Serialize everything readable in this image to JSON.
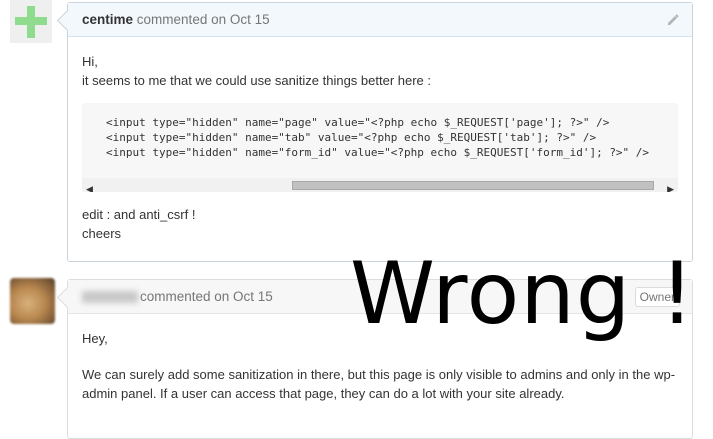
{
  "comment1": {
    "author": "centime",
    "action": "commented on Oct 15",
    "lines": [
      "Hi,",
      "it seems to me that we could use sanitize things better here :"
    ],
    "code_lines": [
      "<input type=\"hidden\" name=\"page\" value=\"<?php echo $_REQUEST['page']; ?>\" />",
      "<input type=\"hidden\" name=\"tab\" value=\"<?php echo $_REQUEST['tab']; ?>\" />",
      "<input type=\"hidden\" name=\"form_id\" value=\"<?php echo $_REQUEST['form_id']; ?>\" />"
    ],
    "after_lines": [
      "edit : and anti_csrf !",
      "cheers"
    ],
    "edit_icon": "pencil-icon"
  },
  "comment2": {
    "author_hidden": true,
    "action": "commented on Oct 15",
    "badge": "Owner",
    "lines": [
      "Hey,",
      "We can surely add some sanitization in there, but this page is only visible to admins and only in the wp-admin panel. If a user can access that page, they can do a lot with your site already."
    ]
  },
  "overlay": {
    "text": "Wrong !"
  },
  "colors": {
    "avatar_plus": "#8fdc8f",
    "header_bg": "#f3f8fd",
    "border": "#cad4dd"
  }
}
